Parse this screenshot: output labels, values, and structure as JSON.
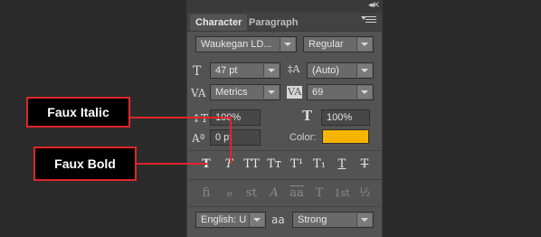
{
  "panel": {
    "tabs": [
      {
        "label": "Character",
        "active": true
      },
      {
        "label": "Paragraph",
        "active": false
      }
    ],
    "collapse_glyph": "◂◂",
    "close_glyph": "×",
    "font_family": "Waukegan LD...",
    "font_style": "Regular",
    "font_size": "47 pt",
    "leading": "(Auto)",
    "kerning": "Metrics",
    "tracking": "69",
    "vertical_scale": "100%",
    "horizontal_scale": "100%",
    "baseline_shift": "0 pt",
    "color_label": "Color:",
    "color_value": "#f5b400",
    "type_style_buttons": [
      {
        "name": "faux-bold",
        "glyph": "T"
      },
      {
        "name": "faux-italic",
        "glyph": "T"
      },
      {
        "name": "all-caps",
        "glyph": "TT"
      },
      {
        "name": "small-caps",
        "glyph": "Tт"
      },
      {
        "name": "superscript",
        "glyph": "T¹"
      },
      {
        "name": "subscript",
        "glyph": "T₁"
      },
      {
        "name": "underline",
        "glyph": "T"
      },
      {
        "name": "strikethrough",
        "glyph": "T"
      }
    ],
    "opentype_buttons": [
      {
        "name": "standard-ligatures",
        "glyph": "fi"
      },
      {
        "name": "contextual-alternates",
        "glyph": "ℴ"
      },
      {
        "name": "discretionary-ligatures",
        "glyph": "st"
      },
      {
        "name": "swash",
        "glyph": "A"
      },
      {
        "name": "stylistic-alternates",
        "glyph": "aa"
      },
      {
        "name": "titling-alternates",
        "glyph": "T"
      },
      {
        "name": "ordinals",
        "glyph": "1st"
      },
      {
        "name": "fractions",
        "glyph": "½"
      }
    ],
    "language": "English: U...",
    "antialias_icon": "aa",
    "antialias": "Strong"
  },
  "callouts": {
    "faux_italic": "Faux Italic",
    "faux_bold": "Faux Bold"
  },
  "colors": {
    "accent_red": "#e0252b",
    "swatch": "#f5b400"
  }
}
